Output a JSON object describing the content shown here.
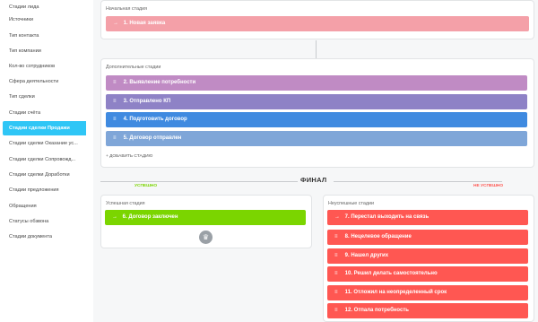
{
  "sidebar": {
    "items": [
      {
        "label": "Стадии лида"
      },
      {
        "label": "Источники"
      },
      {
        "label": "Тип контакта"
      },
      {
        "label": "Тип компании"
      },
      {
        "label": "Кол-во сотрудников"
      },
      {
        "label": "Сфера деятельности"
      },
      {
        "label": "Тип сделки"
      },
      {
        "label": "Стадии счёта"
      },
      {
        "label": "Стадии сделки Продажи"
      },
      {
        "label": "Стадии сделки Оказание ус..."
      },
      {
        "label": "Стадии сделки Сопровожд..."
      },
      {
        "label": "Стадии сделки Доработки"
      },
      {
        "label": "Стадии предложения"
      },
      {
        "label": "Обращения"
      },
      {
        "label": "Статусы обзвона"
      },
      {
        "label": "Стадии документа"
      }
    ],
    "active_index": 8
  },
  "initial": {
    "title": "Начальная стадия",
    "stage": {
      "label": "1. Новая заявка",
      "color": "#f4a0a8",
      "icon": "arrow-right-icon"
    }
  },
  "additional": {
    "title": "Дополнительные стадии",
    "stages": [
      {
        "label": "2. Выявление потребности",
        "color": "#c08bc4",
        "icon": "drag-handle-icon"
      },
      {
        "label": "3. Отправлено КП",
        "color": "#8e82c6",
        "icon": "drag-handle-icon"
      },
      {
        "label": "4. Подготовить договор",
        "color": "#3f8ae0",
        "icon": "drag-handle-icon"
      },
      {
        "label": "5. Договор отправлен",
        "color": "#7fa6d8",
        "icon": "drag-handle-icon"
      }
    ],
    "add_label": "+ ДОБАВИТЬ СТАДИЮ"
  },
  "final": {
    "label": "ФИНАЛ",
    "success_tag": "УСПЕШНО",
    "fail_tag": "НЕ УСПЕШНО",
    "success_color": "#7bd500",
    "fail_color": "#ff5752"
  },
  "success": {
    "title": "Успешная стадия",
    "stage": {
      "label": "6. Договор заключен",
      "color": "#7bd500",
      "icon": "arrow-right-icon"
    }
  },
  "fail": {
    "title": "Неуспешные стадии",
    "stages": [
      {
        "label": "7. Перестал выходить на связь",
        "icon": "arrow-right-icon"
      },
      {
        "label": "8. Нецелевое обращение",
        "icon": "drag-handle-icon"
      },
      {
        "label": "9. Нашел других",
        "icon": "drag-handle-icon"
      },
      {
        "label": "10. Решил делать самостоятельно",
        "icon": "drag-handle-icon"
      },
      {
        "label": "11. Отложил на неопределенный срок",
        "icon": "drag-handle-icon"
      },
      {
        "label": "12. Отпала потребность",
        "icon": "drag-handle-icon"
      }
    ],
    "color": "#ff5752"
  }
}
